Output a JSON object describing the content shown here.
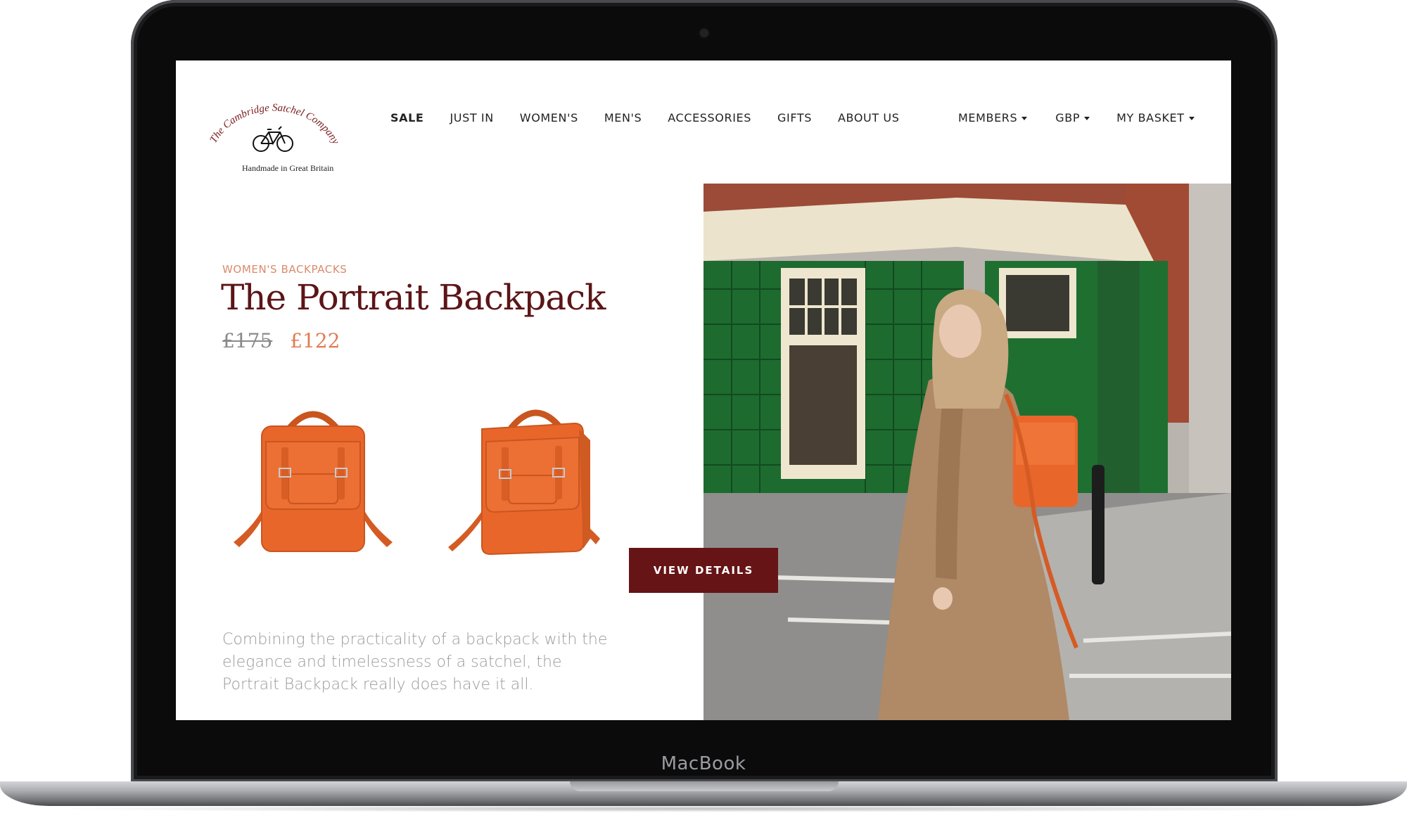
{
  "device": {
    "brand_label": "MacBook"
  },
  "logo": {
    "arc_text": "The Cambridge Satchel Company",
    "tagline": "Handmade in Great Britain",
    "icon": "bicycle-icon"
  },
  "nav": {
    "items": [
      {
        "label": "SALE",
        "bold": true
      },
      {
        "label": "JUST IN"
      },
      {
        "label": "WOMEN'S"
      },
      {
        "label": "MEN'S"
      },
      {
        "label": "ACCESSORIES"
      },
      {
        "label": "GIFTS"
      },
      {
        "label": "ABOUT US"
      }
    ],
    "right_items": [
      {
        "label": "MEMBERS",
        "icon": "caret-down-icon"
      },
      {
        "label": "GBP",
        "icon": "caret-down-icon"
      },
      {
        "label": "MY BASKET",
        "icon": "caret-down-icon"
      }
    ]
  },
  "product": {
    "category": "WOMEN'S BACKPACKS",
    "title": "The Portrait Backpack",
    "price_old": "£175",
    "price_new": "£122",
    "cta_label": "VIEW DETAILS",
    "description": "Combining the practicality of a backpack with the elegance and timelessness of a satchel, the Portrait Backpack really does have it all."
  },
  "colors": {
    "brand_burgundy": "#661416",
    "title_color": "#5c1517",
    "accent_orange": "#e27a55",
    "bag_orange": "#e9662b",
    "tile_green": "#1d6b2f"
  }
}
